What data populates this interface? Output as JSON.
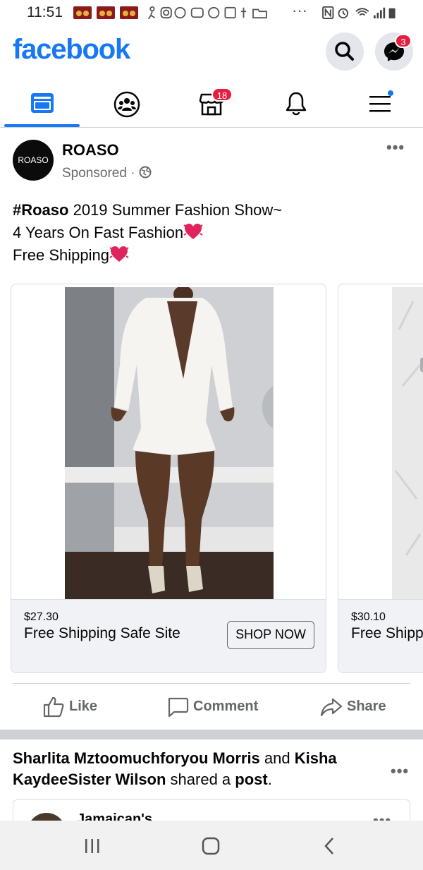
{
  "status_bar": {
    "time": "11:51"
  },
  "header": {
    "logo": "facebook",
    "messenger_badge": "3"
  },
  "nav": {
    "tabs": [
      {
        "name": "home"
      },
      {
        "name": "groups"
      },
      {
        "name": "marketplace",
        "badge": "18"
      },
      {
        "name": "notifications"
      },
      {
        "name": "menu"
      }
    ]
  },
  "post": {
    "page_name": "ROASO",
    "avatar_text": "ROASO",
    "sponsored": "Sponsored",
    "text": {
      "hashtag": "#Roaso",
      "line1_rest": " 2019 Summer Fashion Show~",
      "line2": "4 Years On Fast Fashion",
      "line3": "Free Shipping"
    },
    "cards": [
      {
        "price": "$27.30",
        "title": "Free Shipping Safe Site",
        "button": "SHOP NOW"
      },
      {
        "price": "$30.10",
        "title": "Free Shipping Safe Site"
      }
    ],
    "actions": {
      "like": "Like",
      "comment": "Comment",
      "share": "Share"
    }
  },
  "next_post": {
    "user1": "Sharlita Mztoomuchforyou Morris",
    "and": " and ",
    "user2": "Kisha KaydeeSister Wilson",
    "shared": " shared a ",
    "post_link": "post",
    "period": ".",
    "nested_name": "Jamaican's"
  },
  "colors": {
    "brand": "#1877f2",
    "badge": "#e41e3f"
  }
}
